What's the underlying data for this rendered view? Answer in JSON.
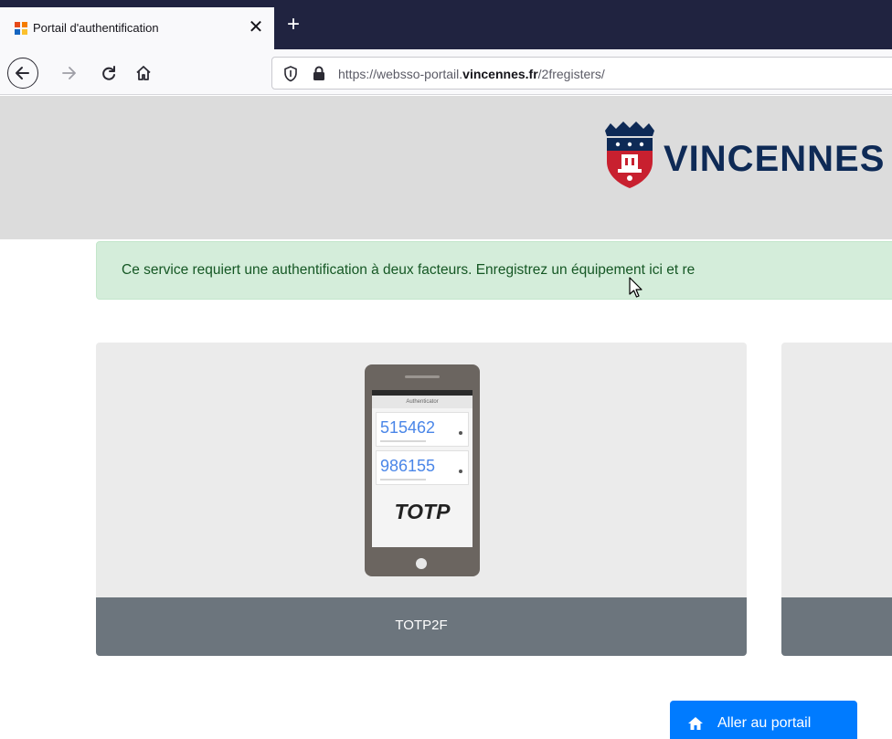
{
  "browser": {
    "tab_title": "Portail d'authentification",
    "tab_close": "✕",
    "new_tab": "+",
    "url_prefix": "https://websso-portail.",
    "url_domain": "vincennes.fr",
    "url_suffix": "/2fregisters/"
  },
  "header": {
    "logo_text": "VINCENNES"
  },
  "alert": {
    "message": "Ce service requiert une authentification à deux facteurs. Enregistrez un équipement ici et re"
  },
  "devices": [
    {
      "label": "TOTP2F",
      "illustration": {
        "app_title": "Authenticator",
        "codes": [
          "515462",
          "986155"
        ],
        "caption": "TOTP"
      }
    },
    {
      "label": ""
    }
  ],
  "actions": {
    "portal_button": "Aller au portail"
  },
  "colors": {
    "tabbar": "#202340",
    "alert_bg": "#d4edda",
    "alert_text": "#155724",
    "card_footer": "#6c757d",
    "primary": "#007bff",
    "logo_text": "#0e2a56",
    "crest_red": "#c8202f"
  }
}
